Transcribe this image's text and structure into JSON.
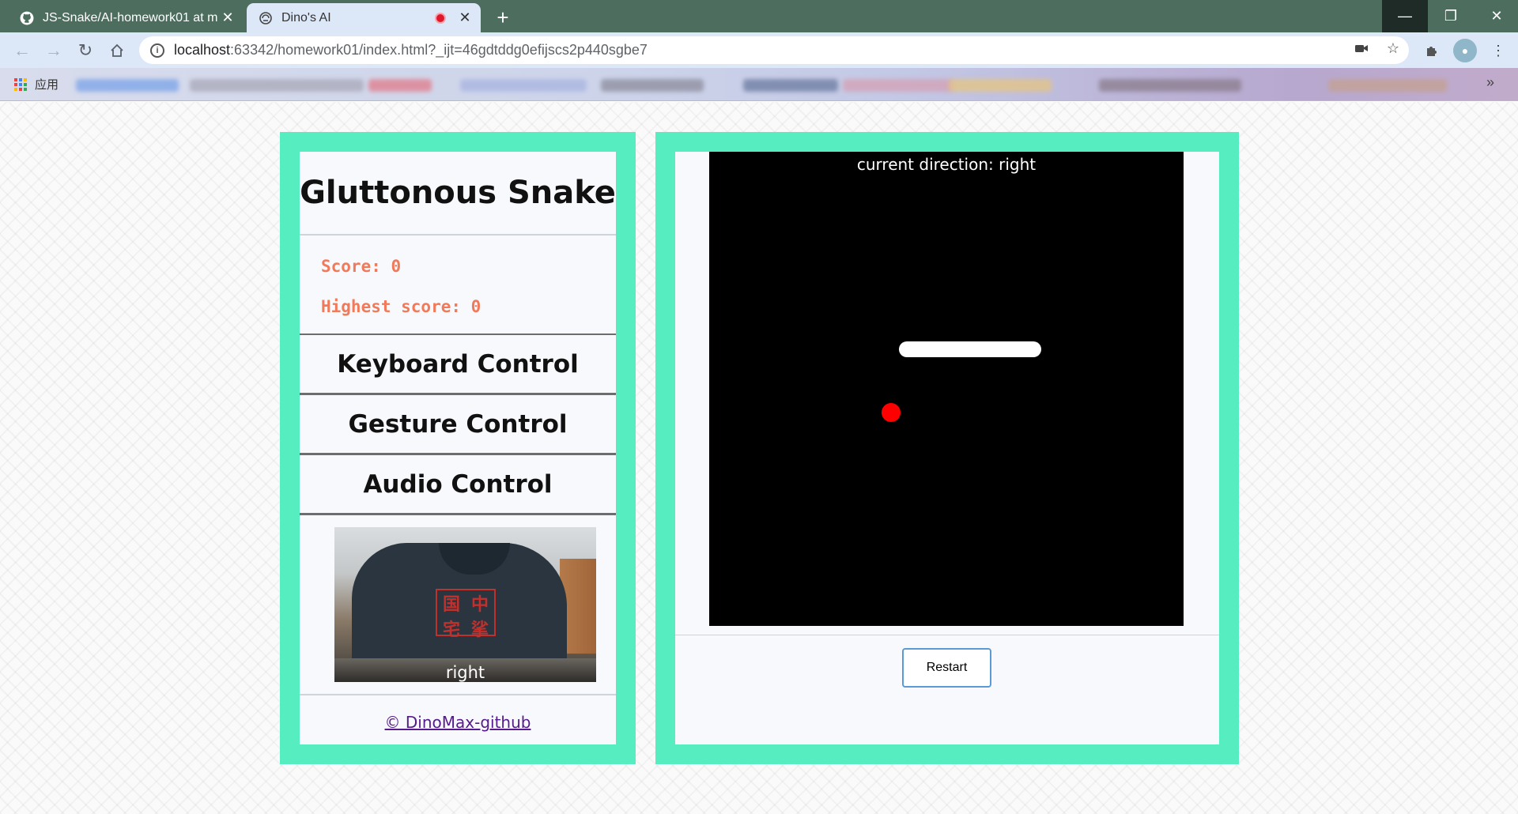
{
  "browser": {
    "tabs": [
      {
        "title": "JS-Snake/AI-homework01 at m",
        "icon": "github-icon",
        "active": false
      },
      {
        "title": "Dino's AI",
        "icon": "dino-ai-icon",
        "active": true,
        "recording": true
      }
    ],
    "new_tab_label": "+",
    "address": {
      "host": "localhost",
      "path": ":63342/homework01/index.html?_ijt=46gdtddg0efijscs2p440sgbe7"
    },
    "bookmarks": {
      "apps_label": "应用",
      "more_label": "»"
    }
  },
  "sidebar": {
    "title": "Gluttonous Snake",
    "score_label": "Score: 0",
    "highest_label": "Highest score: 0",
    "controls": [
      {
        "label": "Keyboard Control"
      },
      {
        "label": "Gesture Control"
      },
      {
        "label": "Audio Control"
      }
    ],
    "webcam_caption": "right",
    "footer_link": "© DinoMax-github"
  },
  "game": {
    "direction_text": "current direction: right",
    "board_cells": 30,
    "snake": [
      [
        20,
        12
      ],
      [
        19,
        12
      ],
      [
        18,
        12
      ],
      [
        17,
        12
      ],
      [
        16,
        12
      ],
      [
        15,
        12
      ],
      [
        14,
        12
      ],
      [
        13,
        12
      ],
      [
        12,
        12
      ]
    ],
    "food": [
      11,
      16
    ],
    "colors": {
      "board": "#000000",
      "snake": "#ffffff",
      "food": "#ff0000",
      "accent": "#56edc1",
      "score": "#f07a5a"
    },
    "restart_label": "Restart"
  }
}
